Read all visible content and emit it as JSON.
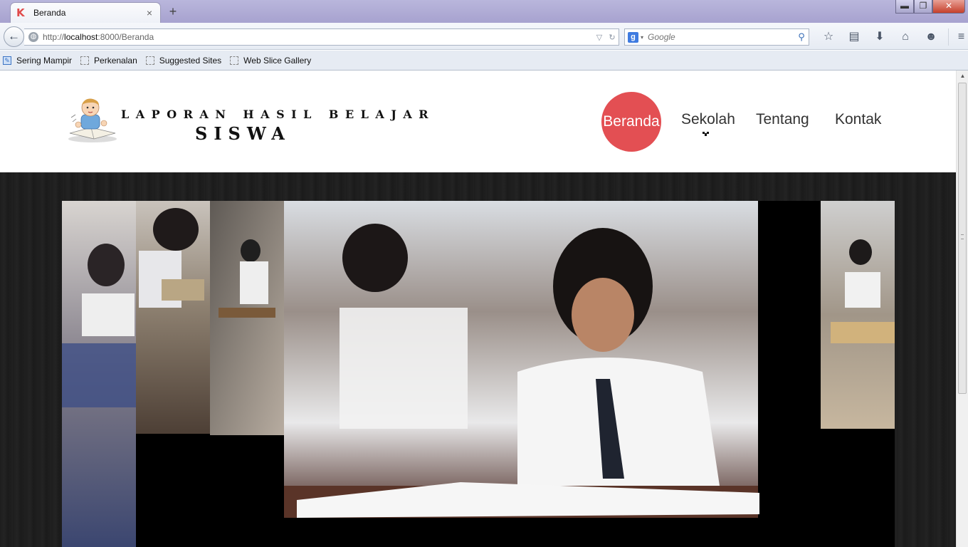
{
  "browser": {
    "tab_title": "Beranda",
    "tab_favicon": "K",
    "tab_close": "×",
    "new_tab": "+",
    "window_controls": {
      "minimize": "▬",
      "maximize": "❐",
      "close": "✕"
    },
    "url_prefix": "http://",
    "url_host": "localhost",
    "url_rest": ":8000/Beranda",
    "search_placeholder": "Google",
    "toolbar_icons": [
      "star-icon",
      "reading-list-icon",
      "download-icon",
      "home-icon",
      "chat-icon",
      "menu-icon"
    ]
  },
  "bookmarks": [
    {
      "label": "Sering Mampir",
      "icon": "most-visited-icon"
    },
    {
      "label": "Perkenalan",
      "icon": "blank-page-icon"
    },
    {
      "label": "Suggested Sites",
      "icon": "blank-page-icon"
    },
    {
      "label": "Web Slice Gallery",
      "icon": "blank-page-icon"
    }
  ],
  "site": {
    "logo_line1": "LAPORAN HASIL BELAJAR",
    "logo_line2": "SISWA",
    "nav": [
      {
        "label": "Beranda",
        "active": true
      },
      {
        "label": "Sekolah",
        "active": false
      },
      {
        "label": "Tentang",
        "active": false
      },
      {
        "label": "Kontak",
        "active": false
      }
    ],
    "accent_color": "#e34f53",
    "hero_background": "#1f1f1f"
  }
}
